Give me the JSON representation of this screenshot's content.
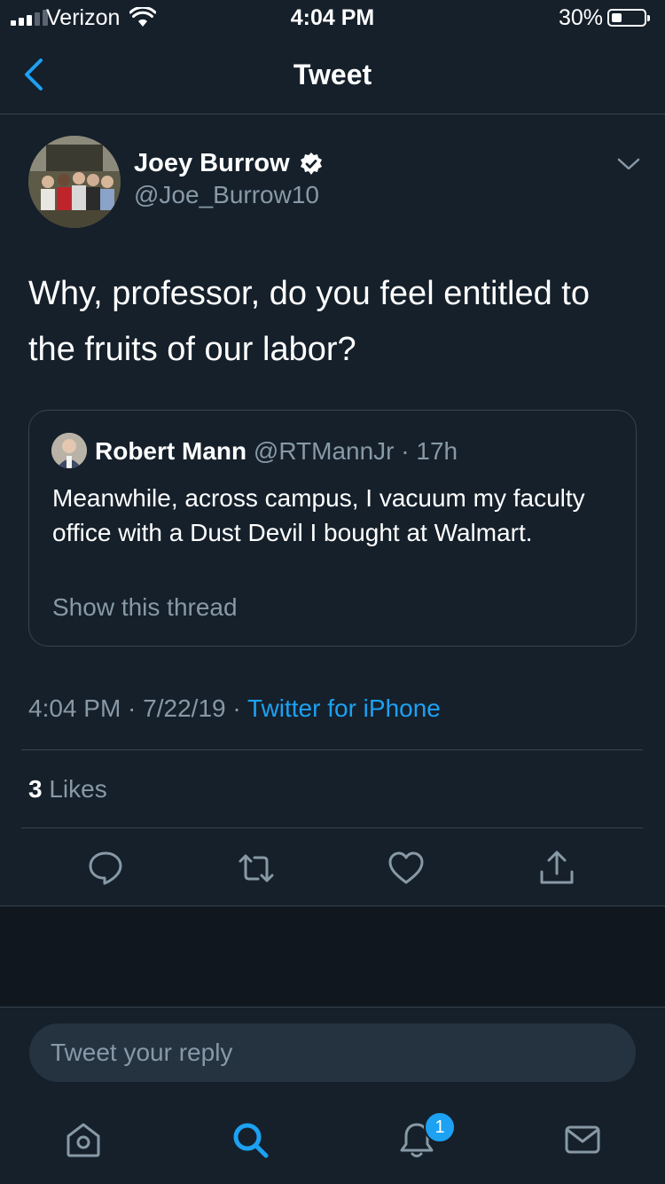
{
  "status_bar": {
    "carrier": "Verizon",
    "time": "4:04 PM",
    "battery_percent": "30%"
  },
  "nav": {
    "title": "Tweet"
  },
  "tweet": {
    "author_name": "Joey Burrow",
    "author_handle": "@Joe_Burrow10",
    "text": "Why, professor, do you feel entitled to the fruits of our labor?",
    "time": "4:04 PM",
    "date": "7/22/19",
    "source": "Twitter for iPhone",
    "likes_count": "3",
    "likes_label": "Likes"
  },
  "quoted_tweet": {
    "author_name": "Robert Mann",
    "author_handle": "@RTMannJr",
    "age": "17h",
    "text": "Meanwhile, across campus, I vacuum my faculty office with a Dust Devil I bought at Walmart.",
    "show_thread": "Show this thread"
  },
  "reply": {
    "placeholder": "Tweet your reply"
  },
  "tab_bar": {
    "notifications_badge": "1"
  },
  "colors": {
    "background": "#15202b",
    "accent": "#1da1f2",
    "muted": "#8899a6",
    "border": "#38444d"
  }
}
